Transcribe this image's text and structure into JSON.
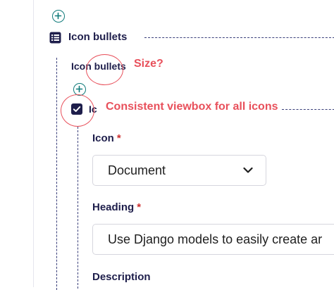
{
  "outer_block": {
    "title": "Icon bullets",
    "icon": "list-icon",
    "add_icon": "plus-circle-icon"
  },
  "child_block": {
    "title": "Icon bullets",
    "add_icon": "plus-circle-icon",
    "item_icon": "checkbox-icon",
    "item_title_partial": "Ic"
  },
  "annotations": {
    "size_note": "Size?",
    "viewbox_note": "Consistent viewbox for all icons",
    "color": "#e8505b"
  },
  "form": {
    "icon_field": {
      "label": "Icon",
      "required_mark": "*",
      "value": "Document",
      "chevron_icon": "chevron-down-icon"
    },
    "heading_field": {
      "label": "Heading",
      "required_mark": "*",
      "value": "Use Django models to easily create ar"
    },
    "description_field": {
      "label": "Description"
    }
  },
  "colors": {
    "text": "#1e1e4b",
    "teal": "#0f7a7a",
    "annotation_red": "#e8505b",
    "required_red": "#cd3232"
  }
}
